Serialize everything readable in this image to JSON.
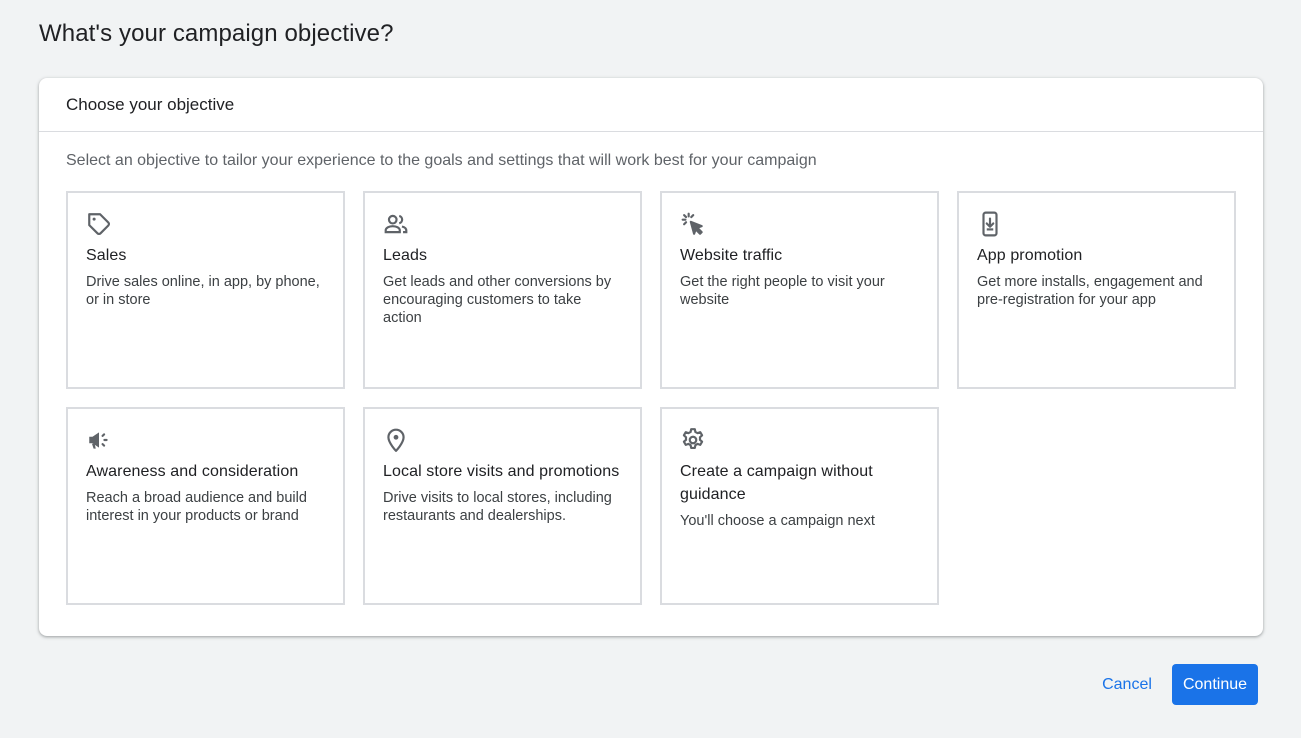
{
  "page": {
    "title": "What's your campaign objective?"
  },
  "panel": {
    "header": "Choose your objective",
    "subtitle": "Select an objective to tailor your experience to the goals and settings that will work best for your campaign"
  },
  "objectives": [
    {
      "icon": "tag-icon",
      "title": "Sales",
      "description": "Drive sales online, in app, by phone, or in store"
    },
    {
      "icon": "people-icon",
      "title": "Leads",
      "description": "Get leads and other conversions by encouraging customers to take action"
    },
    {
      "icon": "cursor-click-icon",
      "title": "Website traffic",
      "description": "Get the right people to visit your website"
    },
    {
      "icon": "phone-download-icon",
      "title": "App promotion",
      "description": "Get more installs, engagement and pre-registration for your app"
    },
    {
      "icon": "megaphone-icon",
      "title": "Awareness and consideration",
      "description": "Reach a broad audience and build interest in your products or brand"
    },
    {
      "icon": "location-pin-icon",
      "title": "Local store visits and promotions",
      "description": "Drive visits to local stores, including restaurants and dealerships."
    },
    {
      "icon": "gear-icon",
      "title": "Create a campaign without guidance",
      "description": "You'll choose a campaign next"
    }
  ],
  "actions": {
    "cancel_label": "Cancel",
    "continue_label": "Continue"
  },
  "colors": {
    "accent": "#1a73e8",
    "icon": "#5f6368",
    "border": "#dadce0",
    "background": "#f1f3f4"
  }
}
